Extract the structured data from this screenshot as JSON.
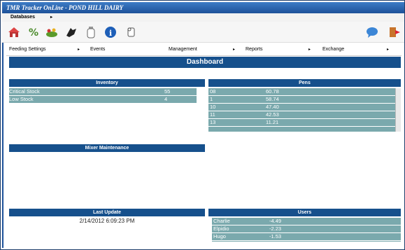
{
  "window": {
    "title": "TMR Tracker OnLine - POND HILL DAIRY"
  },
  "menubar": {
    "databases_label": "Databases",
    "arrow": "▸"
  },
  "toolbar": {
    "icons": [
      "home-icon",
      "percent-icon",
      "feed-icon",
      "mixer-icon",
      "bottle-icon",
      "info-icon",
      "scroll-icon",
      "chat-icon",
      "exit-icon"
    ],
    "accent": "#1d5199"
  },
  "nav": {
    "items": [
      "Feeding Settings",
      "Events",
      "Management",
      "Reports",
      "Exchange"
    ],
    "arrow": "▸"
  },
  "dashboard": {
    "title": "Dashboard"
  },
  "inventory": {
    "title": "Inventory",
    "rows": [
      {
        "label": "Critical Stock",
        "value": "55"
      },
      {
        "label": "Low Stock",
        "value": "4"
      }
    ]
  },
  "pens": {
    "title": "Pens",
    "rows": [
      {
        "label": "08",
        "value": "60.78"
      },
      {
        "label": "1",
        "value": "58.74"
      },
      {
        "label": "10",
        "value": "47.40"
      },
      {
        "label": "11",
        "value": "42.53"
      },
      {
        "label": "13",
        "value": "11.21"
      }
    ]
  },
  "mixer": {
    "title": "Mixer Maintenance"
  },
  "last_update": {
    "title": "Last Update",
    "value": "2/14/2012 6:09:23 PM"
  },
  "users": {
    "title": "Users",
    "rows": [
      {
        "label": "Charlie",
        "value": "-4.49"
      },
      {
        "label": "Elpidio",
        "value": "-2.23"
      },
      {
        "label": "Hugo",
        "value": "-1.53"
      }
    ]
  },
  "colors": {
    "header": "#16508c",
    "teal": "#7aa9ad",
    "title_bar": "#1d5199"
  }
}
